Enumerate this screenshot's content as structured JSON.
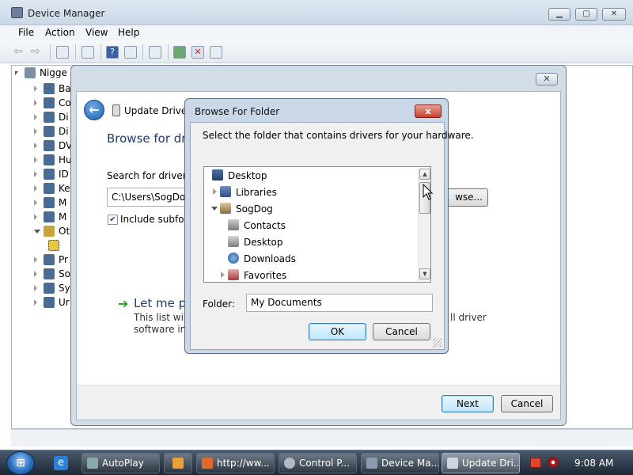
{
  "device_manager": {
    "title": "Device Manager",
    "menu": [
      "File",
      "Action",
      "View",
      "Help"
    ],
    "tree": {
      "root": "Nigge",
      "items": [
        "Ba",
        "Co",
        "Di",
        "Di",
        "DV",
        "Hu",
        "ID",
        "Ke",
        "M",
        "M",
        "Ot",
        "",
        "Pr",
        "So",
        "Sy",
        "Ur"
      ]
    }
  },
  "wizard": {
    "title": "Update Driver S",
    "heading": "Browse for driv",
    "search_label": "Search for driver so",
    "path_value": "C:\\Users\\SogDog\\",
    "browse_label": "wse...",
    "include_subfolders": "Include subfold",
    "include_checked": true,
    "pick_title": "Let me pi",
    "desc_line1": "This list will s",
    "desc_line1_end": "ll driver",
    "desc_line2": "software in t",
    "next_label": "Next",
    "cancel_label": "Cancel"
  },
  "browse_folder": {
    "title": "Browse For Folder",
    "close_label": "x",
    "prompt": "Select the folder that contains drivers for your hardware.",
    "tree": [
      {
        "label": "Desktop",
        "icon": "desktop-icon",
        "expander": "none"
      },
      {
        "label": "Libraries",
        "icon": "libraries-icon",
        "expander": "collapsed"
      },
      {
        "label": "SogDog",
        "icon": "user-folder-icon",
        "expander": "expanded"
      },
      {
        "label": "Contacts",
        "icon": "contacts-icon",
        "expander": "none"
      },
      {
        "label": "Desktop",
        "icon": "desktop-folder-icon",
        "expander": "none"
      },
      {
        "label": "Downloads",
        "icon": "downloads-icon",
        "expander": "none"
      },
      {
        "label": "Favorites",
        "icon": "favorites-icon",
        "expander": "collapsed"
      }
    ],
    "folder_label": "Folder:",
    "folder_value": "My Documents",
    "ok_label": "OK",
    "cancel_label": "Cancel"
  },
  "taskbar": {
    "tasks": [
      {
        "label": "AutoPlay",
        "icon": "autoplay-icon"
      },
      {
        "label": "",
        "icon": "media-player-icon"
      },
      {
        "label": "http://ww...",
        "icon": "browser-icon"
      },
      {
        "label": "Control P...",
        "icon": "control-panel-icon"
      },
      {
        "label": "Device Ma...",
        "icon": "device-manager-icon"
      },
      {
        "label": "Update Dri...",
        "icon": "update-driver-icon"
      }
    ],
    "clock": "9:08 AM"
  },
  "colors": {
    "title_blue": "#1e3c78",
    "accent_green": "#2aa02a",
    "close_red": "#c7432e"
  }
}
